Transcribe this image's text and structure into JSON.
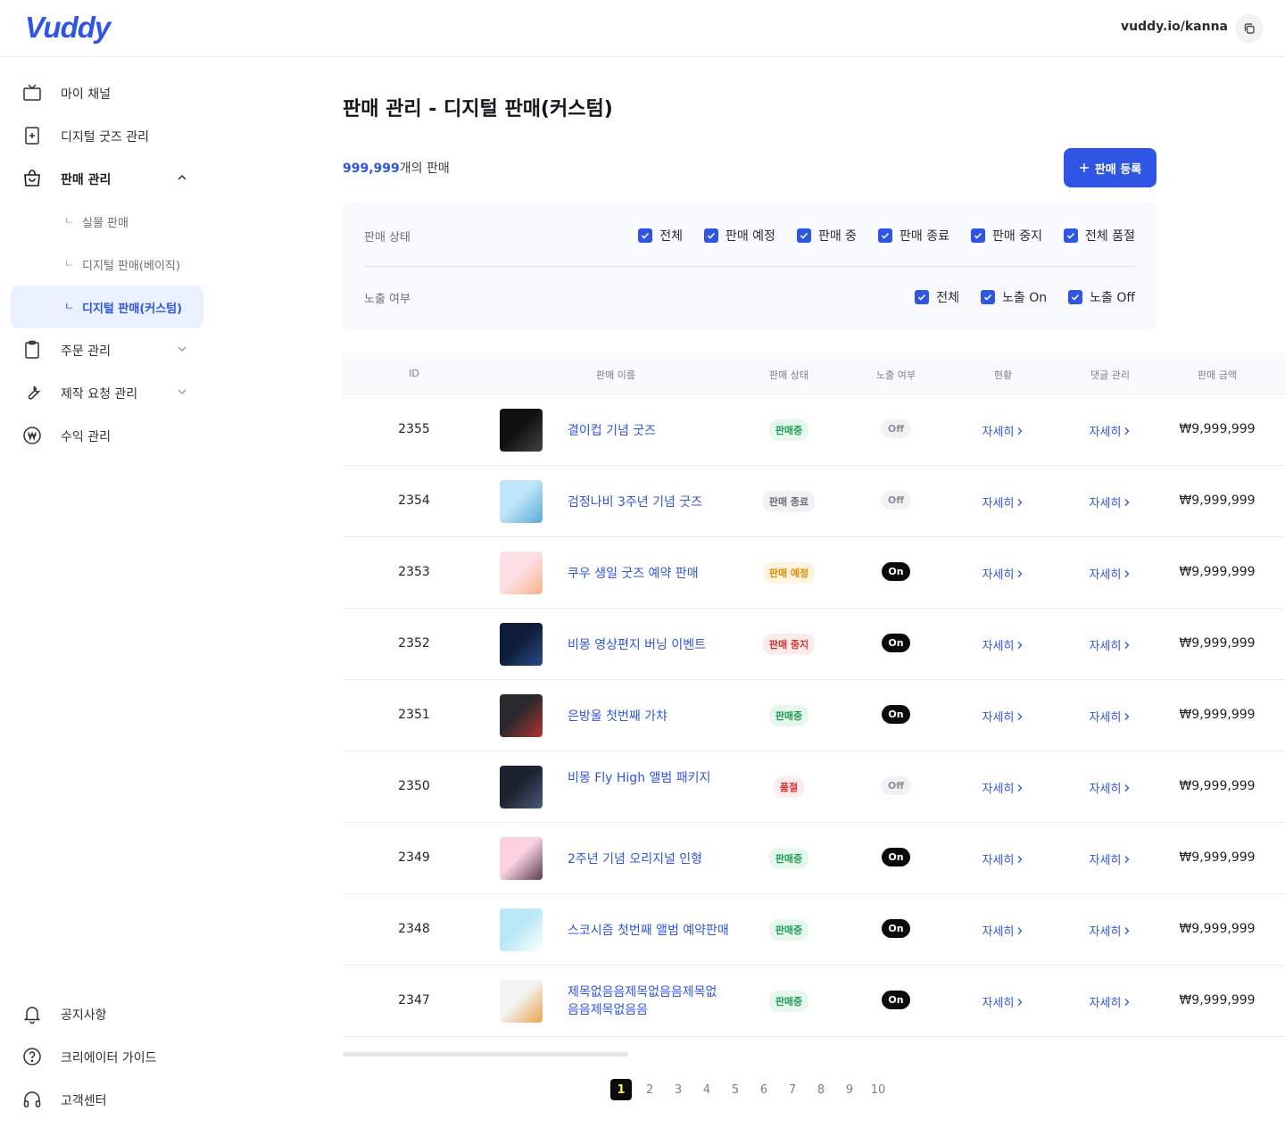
{
  "header": {
    "logo": "Vuddy",
    "channel_url": "vuddy.io/kanna"
  },
  "sidebar": {
    "items": [
      {
        "label": "마이 채널",
        "icon": "tv-icon"
      },
      {
        "label": "디지털 굿즈 관리",
        "icon": "digital-goods-icon"
      },
      {
        "label": "판매 관리",
        "icon": "shopping-bag-icon"
      },
      {
        "label": "실물 판매"
      },
      {
        "label": "디지털 판매(베이직)"
      },
      {
        "label": "디지털 판매(커스텀)"
      },
      {
        "label": "주문 관리",
        "icon": "clipboard-icon"
      },
      {
        "label": "제작 요청 관리",
        "icon": "wrench-icon"
      },
      {
        "label": "수익 관리",
        "icon": "won-icon"
      }
    ],
    "sub_mark": "ㄴ",
    "footer": [
      {
        "label": "공지사항",
        "icon": "bell-icon"
      },
      {
        "label": "크리에이터 가이드",
        "icon": "help-icon"
      },
      {
        "label": "고객센터",
        "icon": "headset-icon"
      }
    ]
  },
  "main": {
    "title": "판매 관리 - 디지털 판매(커스텀)",
    "count_number": "999,999",
    "count_suffix": "개의 판매",
    "register_button": "판매 등록",
    "filters": {
      "status_label": "판매 상태",
      "status_options": [
        "전체",
        "판매 예정",
        "판매 중",
        "판매 종료",
        "판매 중지",
        "전체 품절"
      ],
      "exposure_label": "노출 여부",
      "exposure_options": [
        "전체",
        "노출 On",
        "노출 Off"
      ]
    },
    "table": {
      "headers": [
        "ID",
        "판매 이름",
        "판매 상태",
        "노출 여부",
        "현황",
        "댓글 관리",
        "판매 금액"
      ],
      "detail_label": "자세히",
      "rows": [
        {
          "id": "2355",
          "name": "결이컵 기념 굿즈",
          "status": "판매중",
          "exposure": "Off",
          "price": "₩9,999,999"
        },
        {
          "id": "2354",
          "name": "검정나비 3주년 기념 굿즈",
          "status": "판매 종료",
          "exposure": "Off",
          "price": "₩9,999,999"
        },
        {
          "id": "2353",
          "name": "쿠우 생일 굿즈 예약 판매",
          "status": "판매 예정",
          "exposure": "On",
          "price": "₩9,999,999"
        },
        {
          "id": "2352",
          "name": "비몽 영상편지 버닝 이벤트",
          "status": "판매 중지",
          "exposure": "On",
          "price": "₩9,999,999"
        },
        {
          "id": "2351",
          "name": "은방울 첫번째 가챠",
          "status": "판매중",
          "exposure": "On",
          "price": "₩9,999,999"
        },
        {
          "id": "2350",
          "name": "비몽 Fly High 앨범 패키지",
          "status": "품절",
          "exposure": "Off",
          "price": "₩9,999,999"
        },
        {
          "id": "2349",
          "name": "2주년 기념 오리지널 인형",
          "status": "판매중",
          "exposure": "On",
          "price": "₩9,999,999"
        },
        {
          "id": "2348",
          "name": "스코시즘 첫번째 앨범 예약판매",
          "status": "판매중",
          "exposure": "On",
          "price": "₩9,999,999"
        },
        {
          "id": "2347",
          "name": "제목없음음제목없음음제목없음음제목없음음",
          "status": "판매중",
          "exposure": "On",
          "price": "₩9,999,999"
        }
      ]
    },
    "pagination": {
      "pages": [
        "1",
        "2",
        "3",
        "4",
        "5",
        "6",
        "7",
        "8",
        "9",
        "10"
      ],
      "current": "1"
    }
  },
  "colors": {
    "accent": "#2f55e4",
    "selling_bg": "#e8f7ee",
    "selling_fg": "#1f9d55",
    "ended_bg": "#f1f2f4",
    "ended_fg": "#6c7078",
    "scheduled_bg": "#fff4e0",
    "scheduled_fg": "#e08a00",
    "stopped_bg": "#fdecec",
    "stopped_fg": "#d93030",
    "soldout_bg": "#fdecec",
    "soldout_fg": "#d93030"
  }
}
